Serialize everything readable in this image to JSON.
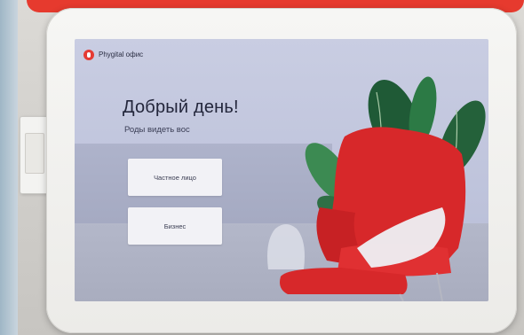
{
  "kiosk": {
    "brand": "Phygital офис",
    "greeting": "Добрый день!",
    "subtitle": "Роды видеть вос",
    "options": [
      {
        "label": "Частное лицо"
      },
      {
        "label": "Бизнес"
      }
    ]
  },
  "colors": {
    "accent": "#e53b34",
    "screen_bg": "#c4c8df",
    "button_bg": "#f2f2f6",
    "chair": "#d7282a",
    "banner": "#e63a2e"
  },
  "icons": {
    "brand_logo": "microphone-icon"
  }
}
